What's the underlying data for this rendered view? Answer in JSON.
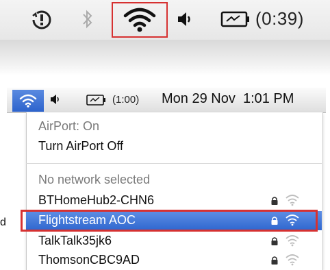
{
  "top_menubar": {
    "icons": [
      "alert-icon",
      "bluetooth-icon",
      "wifi-icon",
      "volume-icon",
      "battery-icon"
    ],
    "battery_time": "(0:39)",
    "highlight_color": "#d63131"
  },
  "menubar": {
    "icons": [
      "wifi-icon",
      "volume-icon",
      "battery-icon"
    ],
    "battery_time": "(1:00)",
    "clock": "Mon 29 Nov  1:01 PM",
    "accent": "#2d63cc"
  },
  "airport_menu": {
    "status": "AirPort: On",
    "toggle_label": "Turn AirPort Off",
    "networks_header": "No network selected",
    "networks": [
      {
        "name": "BTHomeHub2-CHN6",
        "locked": true,
        "selected": false
      },
      {
        "name": "Flightstream AOC",
        "locked": true,
        "selected": true
      },
      {
        "name": "TalkTalk35jk6",
        "locked": true,
        "selected": false
      },
      {
        "name": "ThomsonCBC9AD",
        "locked": true,
        "selected": false
      }
    ]
  },
  "edge_text": "d"
}
